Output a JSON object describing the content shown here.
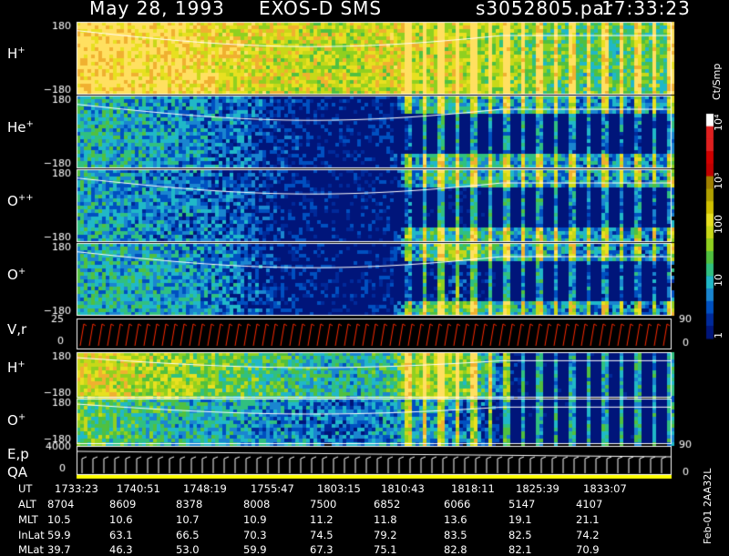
{
  "header": {
    "date": "May 28, 1993",
    "instrument": "EXOS-D SMS",
    "file": "s3052805.par",
    "time": "17:33:23"
  },
  "colorbar": {
    "unit": "Ct/Smp",
    "ticks": [
      "10⁴",
      "10³",
      "100",
      "10",
      "1"
    ]
  },
  "colors": {
    "background": "#000000",
    "plot_bg": "#00157a",
    "trace": "#ffffff",
    "velocity": "#ff2a00",
    "qa_bar": "#ffff00"
  },
  "chart_data": {
    "type": "heatmap",
    "panels": [
      {
        "label": "H",
        "sup": "+",
        "ylim": [
          -180,
          180
        ],
        "intensity": [
          0.95,
          0.95,
          0.9,
          0.9,
          0.85,
          0.8,
          0.75,
          0.72,
          0.7,
          0.7,
          0.75,
          0.8,
          0.85,
          0.75,
          0.7,
          0.65,
          0.6,
          0.6,
          0.62,
          0.62
        ]
      },
      {
        "label": "He",
        "sup": "+",
        "ylim": [
          -180,
          180
        ],
        "intensity": [
          0.4,
          0.38,
          0.35,
          0.32,
          0.28,
          0.25,
          0.15,
          0.08,
          0.05,
          0.05,
          0.1,
          0.5,
          0.5,
          0.45,
          0.45,
          0.45,
          0.4,
          0.4,
          0.38,
          0.38
        ]
      },
      {
        "label": "O",
        "sup": "++",
        "ylim": [
          -180,
          180
        ],
        "intensity": [
          0.38,
          0.35,
          0.3,
          0.28,
          0.25,
          0.2,
          0.12,
          0.06,
          0.03,
          0.03,
          0.05,
          0.5,
          0.55,
          0.5,
          0.45,
          0.45,
          0.4,
          0.4,
          0.38,
          0.38
        ]
      },
      {
        "label": "O",
        "sup": "+",
        "ylim": [
          -180,
          180
        ],
        "intensity": [
          0.4,
          0.4,
          0.38,
          0.35,
          0.3,
          0.25,
          0.15,
          0.08,
          0.03,
          0.03,
          0.05,
          0.55,
          0.7,
          0.55,
          0.5,
          0.45,
          0.4,
          0.38,
          0.35,
          0.35
        ]
      },
      {
        "label": "H",
        "sup": "+",
        "ylim": [
          -180,
          180
        ],
        "intensity": [
          0.75,
          0.75,
          0.7,
          0.65,
          0.6,
          0.55,
          0.5,
          0.45,
          0.4,
          0.4,
          0.45,
          0.8,
          0.75,
          0.55,
          0.1,
          0.05,
          0.05,
          0.05,
          0.05,
          0.05
        ]
      },
      {
        "label": "O",
        "sup": "+",
        "ylim": [
          -180,
          180
        ],
        "intensity": [
          0.55,
          0.5,
          0.45,
          0.42,
          0.38,
          0.35,
          0.3,
          0.28,
          0.25,
          0.25,
          0.3,
          0.45,
          0.4,
          0.3,
          0.05,
          0.05,
          0.05,
          0.05,
          0.05,
          0.05
        ]
      }
    ],
    "velocity_panel": {
      "label": "V,r",
      "ylim": [
        0,
        25
      ],
      "right_ticks": [
        "90",
        "0"
      ]
    },
    "energy_panel": {
      "label": "E,p",
      "label2": "QA",
      "ylim": [
        0,
        4000
      ],
      "right_ticks": [
        "90",
        "0"
      ]
    },
    "x_ticks": [
      "1733:23",
      "1740:51",
      "1748:19",
      "1755:47",
      "1803:15",
      "1810:43",
      "1818:11",
      "1825:39",
      "1833:07"
    ],
    "table": {
      "rows": [
        {
          "name": "UT",
          "values": [
            "1733:23",
            "1740:51",
            "1748:19",
            "1755:47",
            "1803:15",
            "1810:43",
            "1818:11",
            "1825:39",
            "1833:07"
          ]
        },
        {
          "name": "ALT",
          "values": [
            "8704",
            "8609",
            "8378",
            "8008",
            "7500",
            "6852",
            "6066",
            "5147",
            "4107"
          ]
        },
        {
          "name": "MLT",
          "values": [
            "10.5",
            "10.6",
            "10.7",
            "10.9",
            "11.2",
            "11.8",
            "13.6",
            "19.1",
            "21.1"
          ]
        },
        {
          "name": "InLat",
          "values": [
            "59.9",
            "63.1",
            "66.5",
            "70.3",
            "74.5",
            "79.2",
            "83.5",
            "82.5",
            "74.2"
          ]
        },
        {
          "name": "MLat",
          "values": [
            "39.7",
            "46.3",
            "53.0",
            "59.9",
            "67.3",
            "75.1",
            "82.8",
            "82.1",
            "70.9"
          ]
        }
      ]
    }
  },
  "side_label": "Feb-01 2AA32L"
}
